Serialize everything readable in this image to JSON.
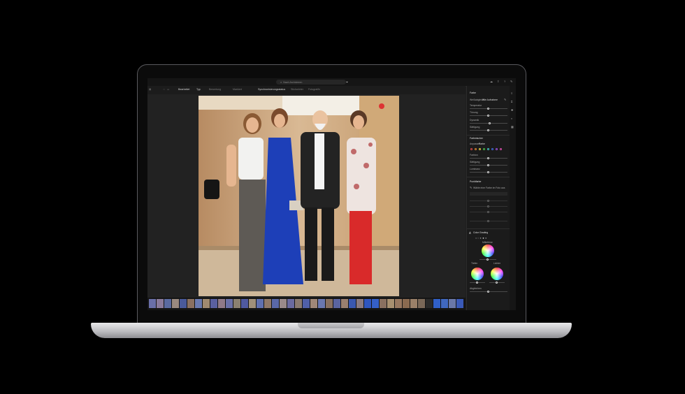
{
  "app": {
    "search_placeholder": "Nach Archivieren"
  },
  "toolbar": {
    "items": [
      "Bearbeitet",
      "Typ",
      "Bewertung",
      "Markiert",
      "Synchronisierungsstatus",
      "Stichwörter",
      "Fotograf/in"
    ]
  },
  "panel": {
    "light": {
      "title": "Farbe",
      "white_balance_label": "Weißabgleich",
      "white_balance_value": "Wie Aufnahme",
      "sliders": [
        "Temperatur",
        "Tönung",
        "Dynamik",
        "Sättigung"
      ]
    },
    "color_mixer": {
      "title": "Farbmischer",
      "adjust_label": "Anpassen",
      "adjust_value": "Farbe",
      "sliders": [
        "Farbton",
        "Sättigung",
        "Luminanz"
      ]
    },
    "point_color": {
      "title": "Punktfarbe",
      "picker_hint": "Wähle eine Farbe im Foto aus"
    },
    "color_grading": {
      "title": "Color Grading",
      "midtones_label": "Mitteltöne",
      "shadows_label": "Tiefen",
      "highlights_label": "Lichter",
      "blending_label": "Abgleichen"
    }
  },
  "colors": {
    "accent": "#e0e0e0",
    "panel_bg": "#1b1b1b",
    "swatches": [
      "#e04848",
      "#e08a30",
      "#e0d040",
      "#48c048",
      "#40c8c8",
      "#4070e0",
      "#a050e0",
      "#e050b0"
    ]
  }
}
